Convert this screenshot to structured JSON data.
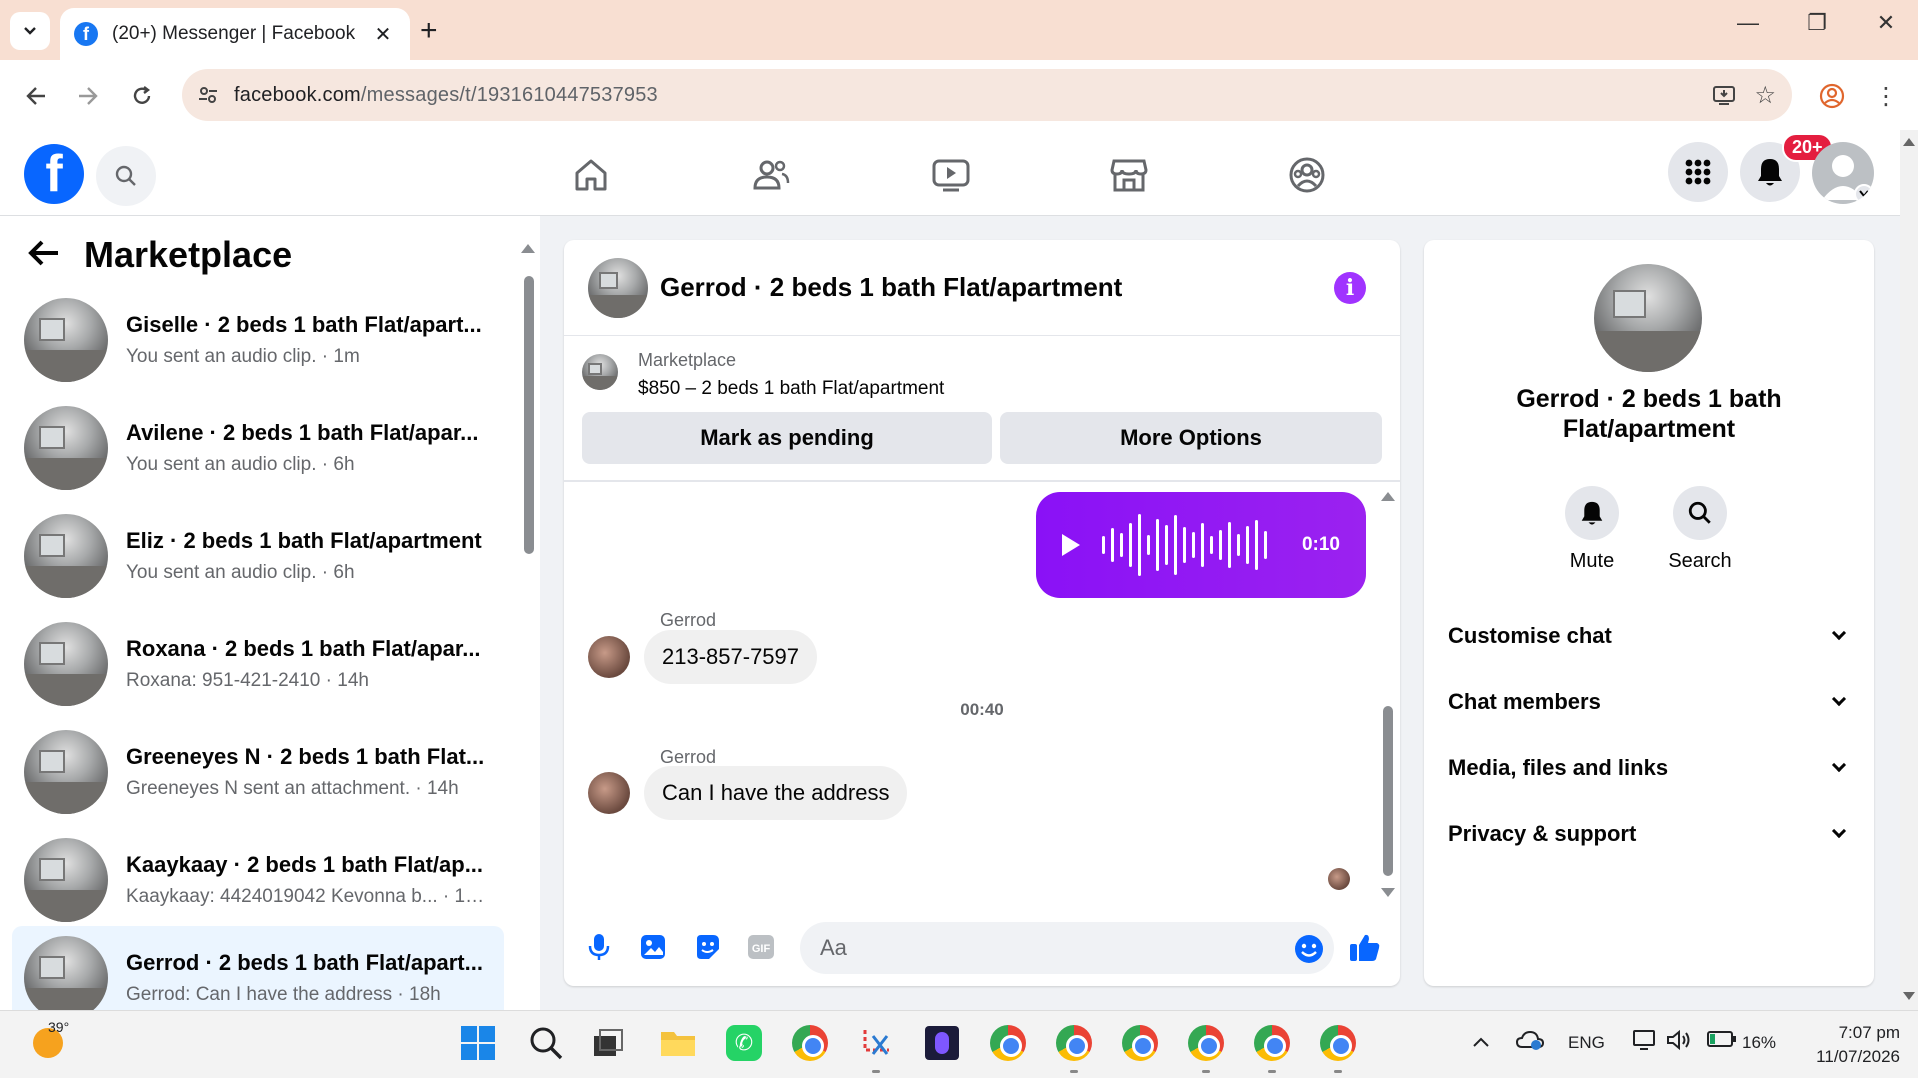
{
  "browser": {
    "tab_title": "(20+) Messenger | Facebook",
    "url_host": "facebook.com",
    "url_path": "/messages/t/1931610447537953"
  },
  "fb_header": {
    "notification_badge": "20+"
  },
  "left_panel": {
    "title": "Marketplace",
    "conversations": [
      {
        "name": "Giselle · 2 beds 1 bath Flat/apart...",
        "preview": "You sent an audio clip. · 1m"
      },
      {
        "name": "Avilene · 2 beds 1 bath Flat/apar...",
        "preview": "You sent an audio clip. · 6h"
      },
      {
        "name": "Eliz · 2 beds 1 bath Flat/apartment",
        "preview": "You sent an audio clip. · 6h"
      },
      {
        "name": "Roxana · 2 beds 1 bath Flat/apar...",
        "preview": "Roxana: 951-421-2410 · 14h"
      },
      {
        "name": "Greeneyes N · 2 beds 1 bath Flat...",
        "preview": "Greeneyes N sent an attachment. · 14h"
      },
      {
        "name": "Kaaykaay · 2 beds 1 bath Flat/ap...",
        "preview": "Kaaykaay: 4424019042 Kevonna b... · 17h"
      },
      {
        "name": "Gerrod · 2 beds 1 bath Flat/apart...",
        "preview": "Gerrod: Can I have the address · 18h"
      }
    ]
  },
  "chat": {
    "title": "Gerrod · 2 beds 1 bath Flat/apartment",
    "marketplace_label": "Marketplace",
    "listing": "$850 – 2 beds 1 bath Flat/apartment",
    "mark_pending": "Mark as pending",
    "more_options": "More Options",
    "audio_duration": "0:10",
    "messages": [
      {
        "sender": "Gerrod",
        "text": "213-857-7597"
      },
      {
        "sender": "Gerrod",
        "text": "Can I have the address"
      }
    ],
    "timestamp": "00:40",
    "composer_placeholder": "Aa"
  },
  "info_panel": {
    "name": "Gerrod · 2 beds 1 bath Flat/apartment",
    "mute": "Mute",
    "search": "Search",
    "sections": [
      "Customise chat",
      "Chat members",
      "Media, files and links",
      "Privacy & support"
    ]
  },
  "taskbar": {
    "weather": "39°",
    "language": "ENG",
    "battery": "16%",
    "time": "7:07 pm",
    "date": "11/07/2026"
  },
  "colors": {
    "facebook_blue": "#0866ff",
    "messenger_purple": "#8e15f5",
    "badge_red": "#e41e3f"
  }
}
